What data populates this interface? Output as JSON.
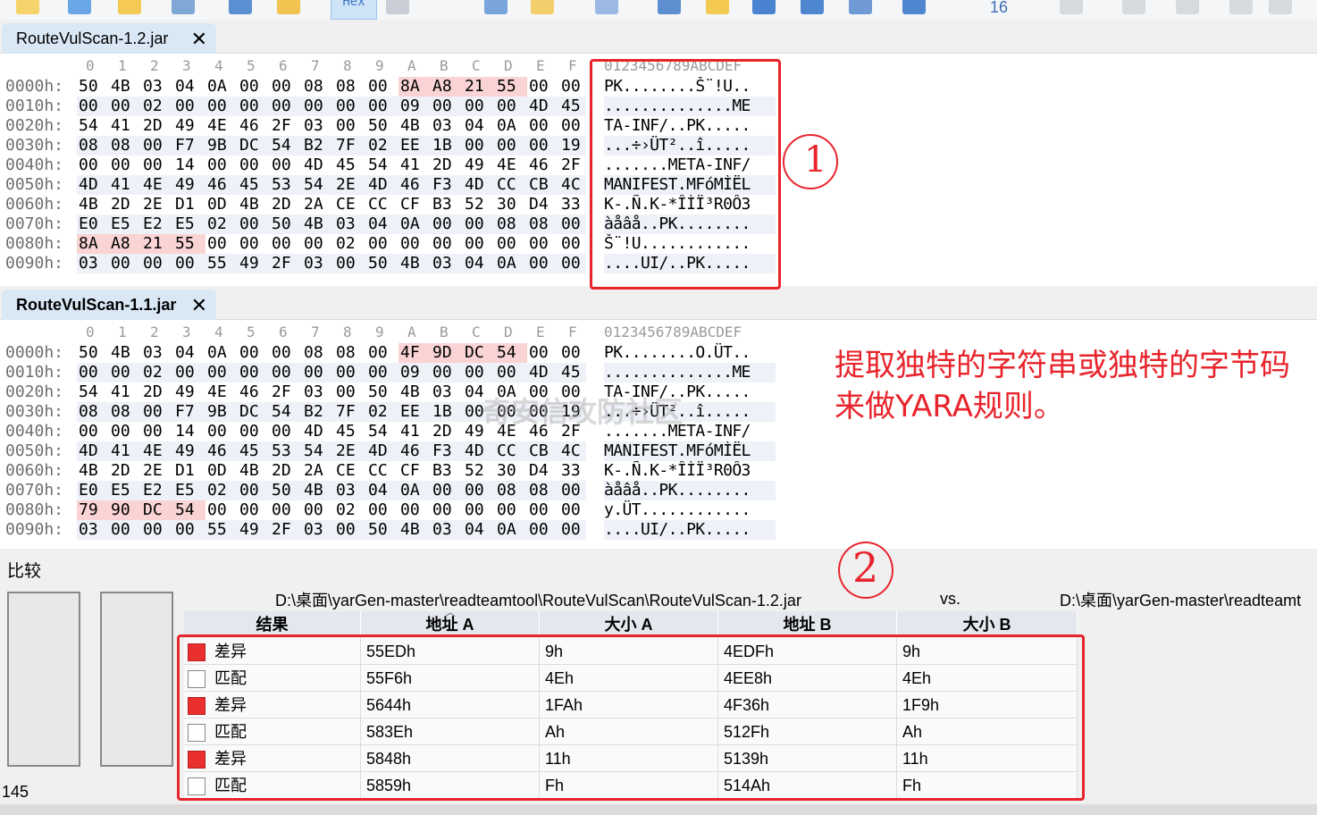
{
  "toolbar": {
    "hex_label": "Hex",
    "zoom_label": "16"
  },
  "tabs": {
    "top": {
      "label": "RouteVulScan-1.2.jar",
      "close": "✕"
    },
    "bottom": {
      "label": "RouteVulScan-1.1.jar",
      "close": "✕"
    }
  },
  "hex": {
    "col_headers": [
      "0",
      "1",
      "2",
      "3",
      "4",
      "5",
      "6",
      "7",
      "8",
      "9",
      "A",
      "B",
      "C",
      "D",
      "E",
      "F"
    ],
    "ascii_header": "0123456789ABCDEF",
    "pane_top": [
      {
        "off": "0000h:",
        "bytes": [
          "50",
          "4B",
          "03",
          "04",
          "0A",
          "00",
          "00",
          "08",
          "08",
          "00",
          "8A",
          "A8",
          "21",
          "55",
          "00",
          "00"
        ],
        "hl": [
          10,
          11,
          12,
          13
        ],
        "ascii": "PK........Š¨!U.."
      },
      {
        "off": "0010h:",
        "bytes": [
          "00",
          "00",
          "02",
          "00",
          "00",
          "00",
          "00",
          "00",
          "00",
          "00",
          "09",
          "00",
          "00",
          "00",
          "4D",
          "45"
        ],
        "hl": [],
        "ascii": "..............ME"
      },
      {
        "off": "0020h:",
        "bytes": [
          "54",
          "41",
          "2D",
          "49",
          "4E",
          "46",
          "2F",
          "03",
          "00",
          "50",
          "4B",
          "03",
          "04",
          "0A",
          "00",
          "00"
        ],
        "hl": [],
        "ascii": "TA-INF/..PK....."
      },
      {
        "off": "0030h:",
        "bytes": [
          "08",
          "08",
          "00",
          "F7",
          "9B",
          "DC",
          "54",
          "B2",
          "7F",
          "02",
          "EE",
          "1B",
          "00",
          "00",
          "00",
          "19"
        ],
        "hl": [],
        "ascii": "...÷›ÜT²..î....."
      },
      {
        "off": "0040h:",
        "bytes": [
          "00",
          "00",
          "00",
          "14",
          "00",
          "00",
          "00",
          "4D",
          "45",
          "54",
          "41",
          "2D",
          "49",
          "4E",
          "46",
          "2F"
        ],
        "hl": [],
        "ascii": ".......META-INF/"
      },
      {
        "off": "0050h:",
        "bytes": [
          "4D",
          "41",
          "4E",
          "49",
          "46",
          "45",
          "53",
          "54",
          "2E",
          "4D",
          "46",
          "F3",
          "4D",
          "CC",
          "CB",
          "4C"
        ],
        "hl": [],
        "ascii": "MANIFEST.MFóMÌËL"
      },
      {
        "off": "0060h:",
        "bytes": [
          "4B",
          "2D",
          "2E",
          "D1",
          "0D",
          "4B",
          "2D",
          "2A",
          "CE",
          "CC",
          "CF",
          "B3",
          "52",
          "30",
          "D4",
          "33"
        ],
        "hl": [],
        "ascii": "K-.Ñ.K-*ÎÌÏ³R0Ô3"
      },
      {
        "off": "0070h:",
        "bytes": [
          "E0",
          "E5",
          "E2",
          "E5",
          "02",
          "00",
          "50",
          "4B",
          "03",
          "04",
          "0A",
          "00",
          "00",
          "08",
          "08",
          "00"
        ],
        "hl": [],
        "ascii": "àåâå..PK........"
      },
      {
        "off": "0080h:",
        "bytes": [
          "8A",
          "A8",
          "21",
          "55",
          "00",
          "00",
          "00",
          "00",
          "02",
          "00",
          "00",
          "00",
          "00",
          "00",
          "00",
          "00"
        ],
        "hl": [
          0,
          1,
          2,
          3
        ],
        "ascii": "Š¨!U............"
      },
      {
        "off": "0090h:",
        "bytes": [
          "03",
          "00",
          "00",
          "00",
          "55",
          "49",
          "2F",
          "03",
          "00",
          "50",
          "4B",
          "03",
          "04",
          "0A",
          "00",
          "00"
        ],
        "hl": [],
        "ascii": "....UI/..PK....."
      }
    ],
    "pane_bottom": [
      {
        "off": "0000h:",
        "bytes": [
          "50",
          "4B",
          "03",
          "04",
          "0A",
          "00",
          "00",
          "08",
          "08",
          "00",
          "4F",
          "9D",
          "DC",
          "54",
          "00",
          "00"
        ],
        "hl": [
          10,
          11,
          12,
          13
        ],
        "ascii": "PK........O.ÜT.."
      },
      {
        "off": "0010h:",
        "bytes": [
          "00",
          "00",
          "02",
          "00",
          "00",
          "00",
          "00",
          "00",
          "00",
          "00",
          "09",
          "00",
          "00",
          "00",
          "4D",
          "45"
        ],
        "hl": [],
        "ascii": "..............ME"
      },
      {
        "off": "0020h:",
        "bytes": [
          "54",
          "41",
          "2D",
          "49",
          "4E",
          "46",
          "2F",
          "03",
          "00",
          "50",
          "4B",
          "03",
          "04",
          "0A",
          "00",
          "00"
        ],
        "hl": [],
        "ascii": "TA-INF/..PK....."
      },
      {
        "off": "0030h:",
        "bytes": [
          "08",
          "08",
          "00",
          "F7",
          "9B",
          "DC",
          "54",
          "B2",
          "7F",
          "02",
          "EE",
          "1B",
          "00",
          "00",
          "00",
          "19"
        ],
        "hl": [],
        "ascii": "...÷›ÜT²..î....."
      },
      {
        "off": "0040h:",
        "bytes": [
          "00",
          "00",
          "00",
          "14",
          "00",
          "00",
          "00",
          "4D",
          "45",
          "54",
          "41",
          "2D",
          "49",
          "4E",
          "46",
          "2F"
        ],
        "hl": [],
        "ascii": ".......META-INF/"
      },
      {
        "off": "0050h:",
        "bytes": [
          "4D",
          "41",
          "4E",
          "49",
          "46",
          "45",
          "53",
          "54",
          "2E",
          "4D",
          "46",
          "F3",
          "4D",
          "CC",
          "CB",
          "4C"
        ],
        "hl": [],
        "ascii": "MANIFEST.MFóMÌËL"
      },
      {
        "off": "0060h:",
        "bytes": [
          "4B",
          "2D",
          "2E",
          "D1",
          "0D",
          "4B",
          "2D",
          "2A",
          "CE",
          "CC",
          "CF",
          "B3",
          "52",
          "30",
          "D4",
          "33"
        ],
        "hl": [],
        "ascii": "K-.Ñ.K-*ÎÌÏ³R0Ô3"
      },
      {
        "off": "0070h:",
        "bytes": [
          "E0",
          "E5",
          "E2",
          "E5",
          "02",
          "00",
          "50",
          "4B",
          "03",
          "04",
          "0A",
          "00",
          "00",
          "08",
          "08",
          "00"
        ],
        "hl": [],
        "ascii": "àåâå..PK........"
      },
      {
        "off": "0080h:",
        "bytes": [
          "79",
          "90",
          "DC",
          "54",
          "00",
          "00",
          "00",
          "00",
          "02",
          "00",
          "00",
          "00",
          "00",
          "00",
          "00",
          "00"
        ],
        "hl": [
          0,
          1,
          2,
          3
        ],
        "ascii": "y.ÜT............"
      },
      {
        "off": "0090h:",
        "bytes": [
          "03",
          "00",
          "00",
          "00",
          "55",
          "49",
          "2F",
          "03",
          "00",
          "50",
          "4B",
          "03",
          "04",
          "0A",
          "00",
          "00"
        ],
        "hl": [],
        "ascii": "....UI/..PK....."
      }
    ]
  },
  "annotation": {
    "text": "提取独特的字符串或独特的字节码来做YARA规则。",
    "marker_1": "1",
    "marker_2": "2"
  },
  "watermark": "奇安信攻防社区",
  "compare": {
    "title": "比较",
    "count": "145",
    "file_a": "D:\\桌面\\yarGen-master\\readteamtool\\RouteVulScan\\RouteVulScan-1.2.jar",
    "vs": "vs.",
    "file_b": "D:\\桌面\\yarGen-master\\readteamt",
    "headers": [
      "结果",
      "地址 A",
      "大小 A",
      "地址 B",
      "大小 B"
    ],
    "rows": [
      {
        "type": "diff",
        "result": "差异",
        "addr_a": "55EDh",
        "size_a": "9h",
        "addr_b": "4EDFh",
        "size_b": "9h"
      },
      {
        "type": "match",
        "result": "匹配",
        "addr_a": "55F6h",
        "size_a": "4Eh",
        "addr_b": "4EE8h",
        "size_b": "4Eh"
      },
      {
        "type": "diff",
        "result": "差异",
        "addr_a": "5644h",
        "size_a": "1FAh",
        "addr_b": "4F36h",
        "size_b": "1F9h"
      },
      {
        "type": "match",
        "result": "匹配",
        "addr_a": "583Eh",
        "size_a": "Ah",
        "addr_b": "512Fh",
        "size_b": "Ah"
      },
      {
        "type": "diff",
        "result": "差异",
        "addr_a": "5848h",
        "size_a": "11h",
        "addr_b": "5139h",
        "size_b": "11h"
      },
      {
        "type": "match",
        "result": "匹配",
        "addr_a": "5859h",
        "size_a": "Fh",
        "addr_b": "514Ah",
        "size_b": "Fh"
      }
    ]
  },
  "colors": {
    "highlight": "#fad4d4",
    "annotation": "#e8242c",
    "diff": "#ea2f2f",
    "tab": "#dae8f6"
  }
}
